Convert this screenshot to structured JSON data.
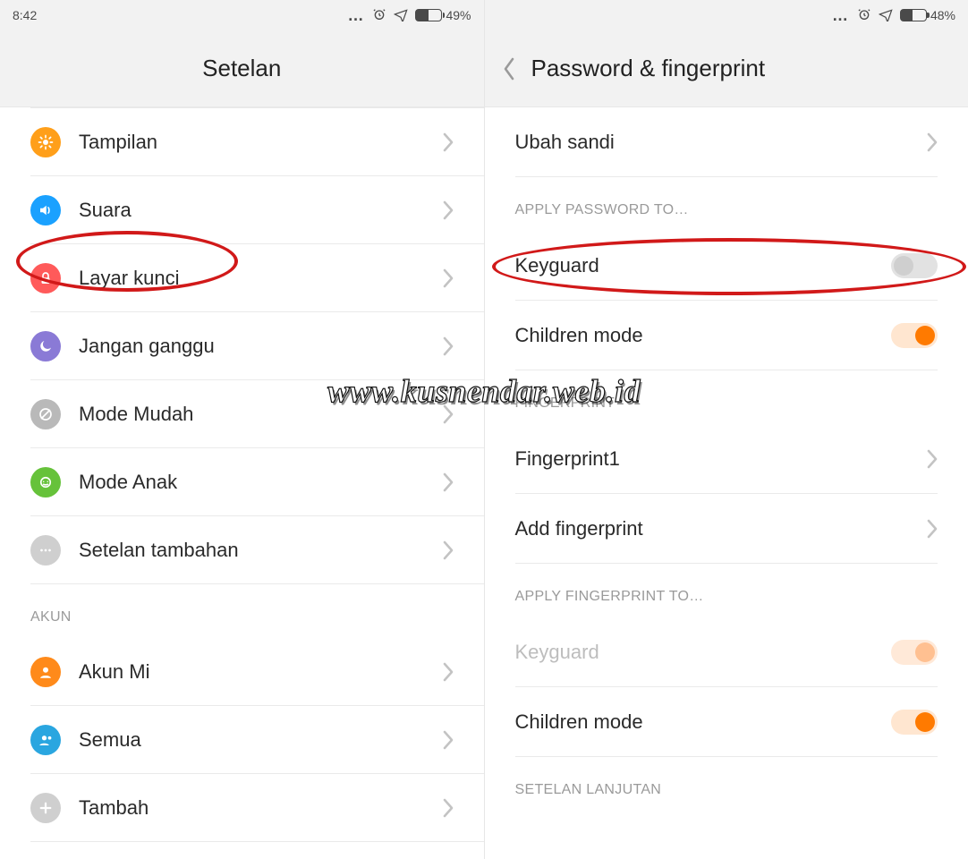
{
  "watermark": "www.kusnendar.web.id",
  "left": {
    "status": {
      "time": "8:42",
      "battery_pct": "49%",
      "battery_fill": 49
    },
    "title": "Setelan",
    "items": [
      {
        "label": "Tampilan",
        "icon": "display-icon",
        "iconClass": "ic-bg-orange"
      },
      {
        "label": "Suara",
        "icon": "volume-icon",
        "iconClass": "ic-bg-bluevol"
      },
      {
        "label": "Layar kunci",
        "icon": "lock-icon",
        "iconClass": "ic-bg-redlock"
      },
      {
        "label": "Jangan ganggu",
        "icon": "moon-icon",
        "iconClass": "ic-bg-purple"
      },
      {
        "label": "Mode Mudah",
        "icon": "nohand-icon",
        "iconClass": "ic-bg-grey"
      },
      {
        "label": "Mode Anak",
        "icon": "child-icon",
        "iconClass": "ic-bg-green"
      },
      {
        "label": "Setelan tambahan",
        "icon": "more-icon",
        "iconClass": "ic-bg-ltgrey"
      }
    ],
    "section_account": "AKUN",
    "account_items": [
      {
        "label": "Akun Mi",
        "icon": "mi-icon",
        "iconClass": "ic-bg-mi"
      },
      {
        "label": "Semua",
        "icon": "people-icon",
        "iconClass": "ic-bg-cyan"
      },
      {
        "label": "Tambah",
        "icon": "plus-icon",
        "iconClass": "ic-bg-add"
      }
    ]
  },
  "right": {
    "status": {
      "time": "",
      "battery_pct": "48%",
      "battery_fill": 48
    },
    "title": "Password & fingerprint",
    "rows": {
      "change_pw": "Ubah sandi",
      "section_apply_pw": "APPLY PASSWORD TO…",
      "keyguard": "Keyguard",
      "children": "Children mode",
      "section_fp": "FINGERPRINT",
      "fp1": "Fingerprint1",
      "add_fp": "Add fingerprint",
      "section_apply_fp": "APPLY FINGERPRINT TO…",
      "keyguard2": "Keyguard",
      "children2": "Children mode",
      "section_adv": "SETELAN LANJUTAN"
    }
  }
}
